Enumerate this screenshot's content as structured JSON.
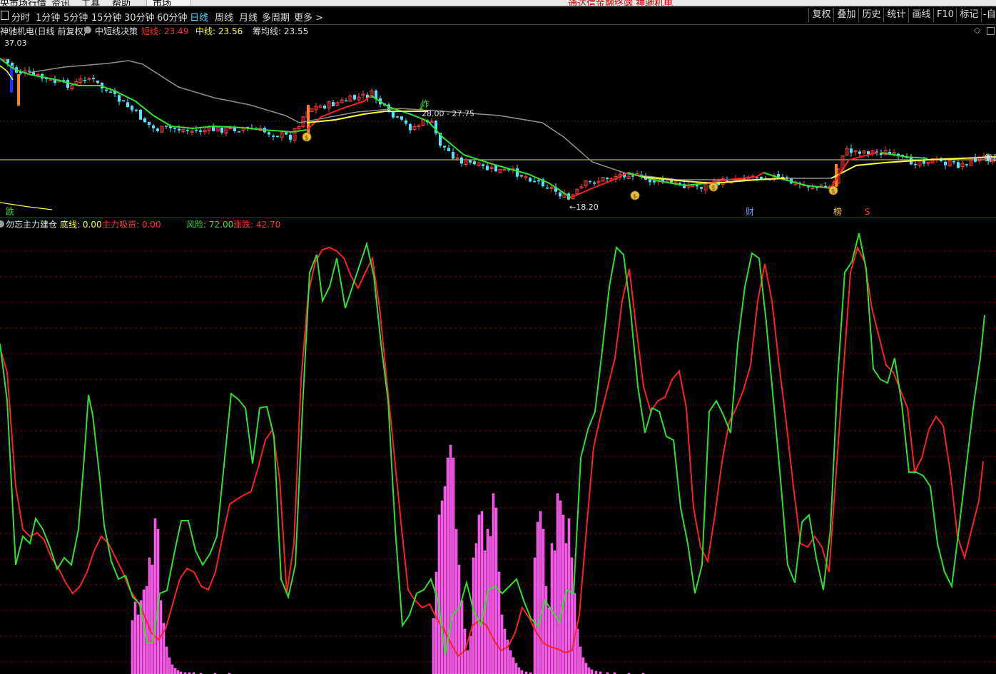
{
  "menu": {
    "items": [
      "央市场行情",
      "资讯",
      "工具",
      "帮助",
      "市场"
    ],
    "ad_text": "通达信金融终端  神驰机电"
  },
  "toolbar": {
    "periods": [
      "分时",
      "1分钟",
      "5分钟",
      "15分钟",
      "30分钟",
      "60分钟",
      "日线",
      "周线",
      "月线",
      "多周期",
      "更多 >"
    ],
    "active_period": "日线",
    "right_buttons": [
      "复权",
      "叠加",
      "历史",
      "统计",
      "画线",
      "F10",
      "标记"
    ],
    "corner_label": "-自"
  },
  "main_info": {
    "stock_name": "神驰机电(日线 前复权)",
    "indicator_name": "中短线决策",
    "short_label": "短线: 23.49",
    "mid_label": "中线: 23.56",
    "chip_label": "筹均线: 23.55"
  },
  "main_chart": {
    "high_label": "37.03",
    "low_label": "←18.20",
    "range_label": "28.00 - 27.75",
    "zha_label": "炸",
    "die_label": "跌",
    "cai_label": "财",
    "bang_label": "榜",
    "s_label": "S",
    "chip_right_label": "筹码",
    "money_icon_text": "$",
    "colors": {
      "up": "#ff3b3b",
      "down": "#4de6ff",
      "short": "#ff2020",
      "mid": "#30e030",
      "yellow": "#ffff40",
      "chip": "#909090"
    }
  },
  "sub_info": {
    "indicator_name": "勿忘主力建仓",
    "bottom_label": "底线: 0.00",
    "main_absorb_label": "主力吸货: 0.00",
    "risk_label": "风险: 72.00",
    "change_label": "涨跌: 42.70"
  },
  "colors": {
    "green_line": "#30e030",
    "red_line": "#ff2020",
    "histogram": "#ff44ee",
    "grid": "#7a0000",
    "label_red": "#ff3030",
    "label_green": "#30e030",
    "label_yellow": "#ffff40",
    "label_white": "#e0e0e0"
  }
}
